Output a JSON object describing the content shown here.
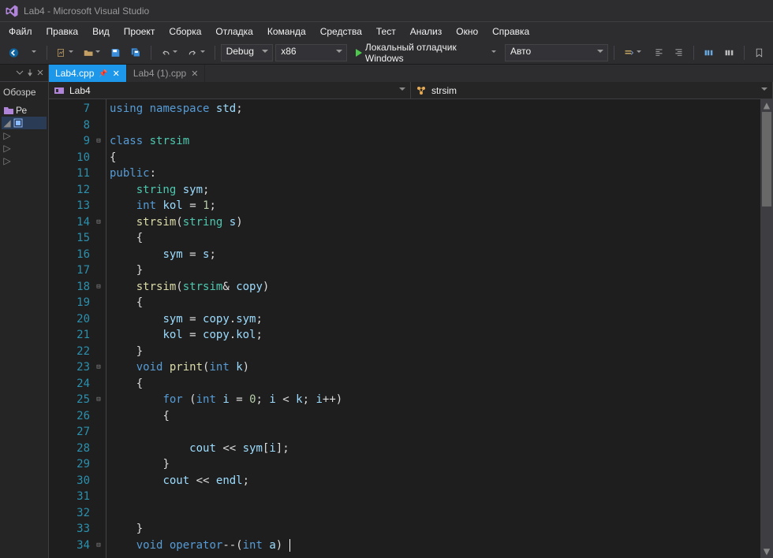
{
  "window": {
    "title": "Lab4 - Microsoft Visual Studio"
  },
  "menu": {
    "items": [
      "Файл",
      "Правка",
      "Вид",
      "Проект",
      "Сборка",
      "Отладка",
      "Команда",
      "Средства",
      "Тест",
      "Анализ",
      "Окно",
      "Справка"
    ]
  },
  "toolbar": {
    "config": "Debug",
    "platform": "x86",
    "debug_target": "Локальный отладчик Windows",
    "right_dropdown": "Авто"
  },
  "left_panel": {
    "obz_label": "Обозре",
    "rows": [
      {
        "label": "Ре"
      }
    ]
  },
  "tabs": {
    "items": [
      {
        "label": "Lab4.cpp",
        "active": true,
        "pinned": true
      },
      {
        "label": "Lab4 (1).cpp",
        "active": false,
        "pinned": false
      }
    ]
  },
  "navbar": {
    "left_label": "Lab4",
    "right_label": "strsim"
  },
  "code": {
    "first_line_no": 7,
    "lines": [
      {
        "n": 7,
        "fold": "",
        "html": "<span class='kw'>using</span> <span class='kw'>namespace</span> <span class='id'>std</span><span class='pun'>;</span>"
      },
      {
        "n": 8,
        "fold": "",
        "html": ""
      },
      {
        "n": 9,
        "fold": "⊟",
        "html": "<span class='kw'>class</span> <span class='typ'>strsim</span>"
      },
      {
        "n": 10,
        "fold": "",
        "html": "<span class='pun'>{</span>"
      },
      {
        "n": 11,
        "fold": "",
        "html": "<span class='kw'>public</span><span class='pun'>:</span>"
      },
      {
        "n": 12,
        "fold": "",
        "html": "    <span class='typ'>string</span> <span class='id'>sym</span><span class='pun'>;</span>"
      },
      {
        "n": 13,
        "fold": "",
        "html": "    <span class='kw'>int</span> <span class='id'>kol</span> <span class='op'>=</span> <span class='num'>1</span><span class='pun'>;</span>"
      },
      {
        "n": 14,
        "fold": "⊟",
        "html": "    <span class='fn'>strsim</span><span class='pun'>(</span><span class='typ'>string</span> <span class='id'>s</span><span class='pun'>)</span>"
      },
      {
        "n": 15,
        "fold": "",
        "html": "    <span class='pun'>{</span>"
      },
      {
        "n": 16,
        "fold": "",
        "html": "        <span class='id'>sym</span> <span class='op'>=</span> <span class='id'>s</span><span class='pun'>;</span>"
      },
      {
        "n": 17,
        "fold": "",
        "html": "    <span class='pun'>}</span>"
      },
      {
        "n": 18,
        "fold": "⊟",
        "html": "    <span class='fn'>strsim</span><span class='pun'>(</span><span class='typ'>strsim</span><span class='op'>&amp;</span> <span class='id'>copy</span><span class='pun'>)</span>"
      },
      {
        "n": 19,
        "fold": "",
        "html": "    <span class='pun'>{</span>"
      },
      {
        "n": 20,
        "fold": "",
        "html": "        <span class='id'>sym</span> <span class='op'>=</span> <span class='id'>copy</span><span class='pun'>.</span><span class='id'>sym</span><span class='pun'>;</span>"
      },
      {
        "n": 21,
        "fold": "",
        "html": "        <span class='id'>kol</span> <span class='op'>=</span> <span class='id'>copy</span><span class='pun'>.</span><span class='id'>kol</span><span class='pun'>;</span>"
      },
      {
        "n": 22,
        "fold": "",
        "html": "    <span class='pun'>}</span>"
      },
      {
        "n": 23,
        "fold": "⊟",
        "html": "    <span class='kw'>void</span> <span class='fn'>print</span><span class='pun'>(</span><span class='kw'>int</span> <span class='id'>k</span><span class='pun'>)</span>"
      },
      {
        "n": 24,
        "fold": "",
        "html": "    <span class='pun'>{</span>"
      },
      {
        "n": 25,
        "fold": "⊟",
        "html": "        <span class='kw'>for</span> <span class='pun'>(</span><span class='kw'>int</span> <span class='id'>i</span> <span class='op'>=</span> <span class='num'>0</span><span class='pun'>;</span> <span class='id'>i</span> <span class='op'>&lt;</span> <span class='id'>k</span><span class='pun'>;</span> <span class='id'>i</span><span class='op'>++</span><span class='pun'>)</span>"
      },
      {
        "n": 26,
        "fold": "",
        "html": "        <span class='pun'>{</span>"
      },
      {
        "n": 27,
        "fold": "",
        "html": ""
      },
      {
        "n": 28,
        "fold": "",
        "html": "            <span class='id'>cout</span> <span class='op'>&lt;&lt;</span> <span class='id'>sym</span><span class='pun'>[</span><span class='id'>i</span><span class='pun'>];</span>"
      },
      {
        "n": 29,
        "fold": "",
        "html": "        <span class='pun'>}</span>"
      },
      {
        "n": 30,
        "fold": "",
        "html": "        <span class='id'>cout</span> <span class='op'>&lt;&lt;</span> <span class='id'>endl</span><span class='pun'>;</span>"
      },
      {
        "n": 31,
        "fold": "",
        "html": ""
      },
      {
        "n": 32,
        "fold": "",
        "html": ""
      },
      {
        "n": 33,
        "fold": "",
        "html": "    <span class='pun'>}</span>"
      },
      {
        "n": 34,
        "fold": "⊟",
        "html": "    <span class='kw'>void</span> <span class='kw'>operator</span><span class='op'>--</span><span class='pun'>(</span><span class='kw'>int</span> <span class='id'>a</span><span class='pun'>)</span> <span class='caret'></span>"
      }
    ]
  }
}
